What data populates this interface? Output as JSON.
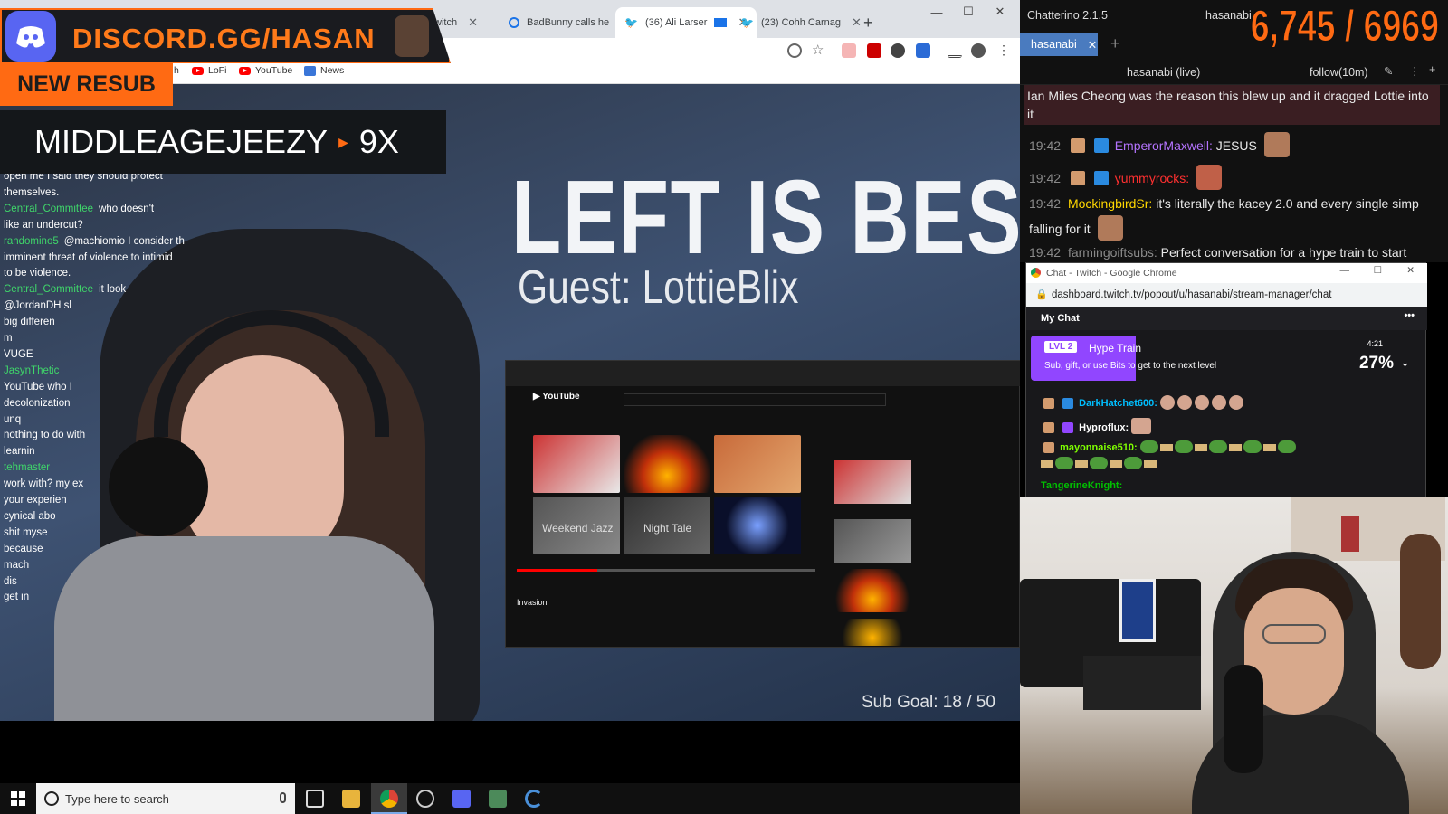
{
  "browser": {
    "tabs": [
      {
        "label": "witch",
        "active": false
      },
      {
        "label": "BadBunny calls he",
        "active": false
      },
      {
        "label": "(36) Ali Larser",
        "active": true
      },
      {
        "label": "(23) Cohh Carnag",
        "active": false
      }
    ],
    "bookmarks": [
      "h",
      "LoFi",
      "YouTube",
      "News"
    ]
  },
  "overlay": {
    "discord": "DISCORD.GG/HASAN",
    "new_resub": "NEW RESUB",
    "resub_user": "MIDDLEAGEJEEZY",
    "resub_months": "9X",
    "sub_goal": "Sub Goal: 18 / 50",
    "counter": "6,745 / 6969"
  },
  "video": {
    "title": "LEFT IS BEST",
    "guest": "Guest: LottieBlix",
    "yt_thumbs": [
      "Weekend Jazz",
      "Night Tale"
    ],
    "yt_title": "Invasion",
    "yt_progress": 0.27
  },
  "left_chat": [
    {
      "user": "",
      "text": "open me I said they should protect"
    },
    {
      "user": "",
      "text": "themselves."
    },
    {
      "user": "Central_Committee",
      "text": "who doesn't"
    },
    {
      "user": "",
      "text": "like an undercut?"
    },
    {
      "user": "randomino5",
      "text": "@machiomio I consider th"
    },
    {
      "user": "",
      "text": "imminent threat of violence to intimid"
    },
    {
      "user": "",
      "text": "to be violence."
    },
    {
      "user": "Central_Committee",
      "text": "it look"
    },
    {
      "user": "",
      "text": "@JordanDH sl"
    },
    {
      "user": "",
      "text": "big differen"
    },
    {
      "user": "",
      "text": "m"
    },
    {
      "user": "",
      "text": "VUGE"
    },
    {
      "user": "JasynThetic",
      "text": ""
    },
    {
      "user": "",
      "text": "YouTube who I"
    },
    {
      "user": "",
      "text": "decolonization"
    },
    {
      "user": "",
      "text": "unq"
    },
    {
      "user": "",
      "text": "nothing to do with"
    },
    {
      "user": "",
      "text": "learnin"
    },
    {
      "user": "tehmaster",
      "text": ""
    },
    {
      "user": "",
      "text": "work with? my ex"
    },
    {
      "user": "",
      "text": "your experien"
    },
    {
      "user": "",
      "text": "cynical abo"
    },
    {
      "user": "",
      "text": "shit myse"
    },
    {
      "user": "",
      "text": "because"
    },
    {
      "user": "",
      "text": "mach"
    },
    {
      "user": "",
      "text": "dis"
    },
    {
      "user": "",
      "text": "get in"
    }
  ],
  "chatterino": {
    "app": "Chatterino 2.1.5",
    "account": "hasanabi",
    "tab": "hasanabi",
    "channel": "hasanabi (live)",
    "mode": "follow(10m)",
    "messages": [
      {
        "ts": "",
        "user": "",
        "text": "Ian Miles Cheong was the reason this blew up and it dragged Lottie into it",
        "color": "#e8e8e8"
      },
      {
        "ts": "19:42",
        "user": "EmperorMaxwell:",
        "text": "JESUS",
        "color": "#b574ff"
      },
      {
        "ts": "19:42",
        "user": "yummyrocks:",
        "text": "",
        "color": "#ff3030"
      },
      {
        "ts": "19:42",
        "user": "MockingbirdSr:",
        "text": "it's literally the kacey 2.0 and every single simp falling for it",
        "color": "#ffd700"
      },
      {
        "ts": "19:42",
        "user": "farmingoiftsubs:",
        "text": "Perfect conversation for a hype train to start",
        "color": "#e8e8e8"
      }
    ]
  },
  "popout": {
    "title": "Chat - Twitch - Google Chrome",
    "url": "dashboard.twitch.tv/popout/u/hasanabi/stream-manager/chat",
    "header": "My Chat",
    "hype": {
      "level": "LVL 2",
      "name": "Hype Train",
      "sub": "Sub, gift, or use Bits to get to the next level",
      "time": "4:21",
      "percent": "27%",
      "fill": 0.27
    },
    "messages": [
      {
        "user": "DarkHatchet600:",
        "color": "#00bfff"
      },
      {
        "user": "Hyproflux:",
        "color": "#ffffff"
      },
      {
        "user": "mayonnaise510:",
        "color": "#7fff00"
      },
      {
        "user": "TangerineKnight:",
        "color": "#00c000"
      }
    ]
  },
  "taskbar": {
    "search_placeholder": "Type here to search"
  },
  "colors": {
    "accent": "#ff6a13",
    "twitch": "#9146ff",
    "chatterino_tab": "#4a7bbf"
  }
}
